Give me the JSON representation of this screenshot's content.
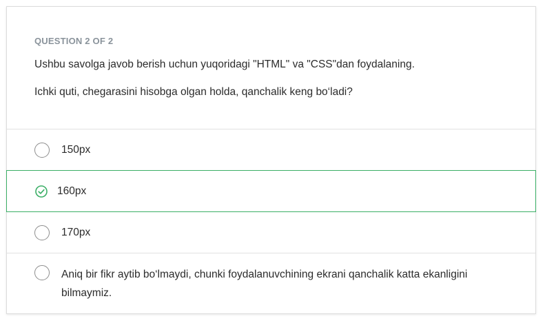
{
  "question": {
    "counter": "QUESTION 2 OF 2",
    "text": "Ushbu savolga javob berish uchun yuqoridagi \"HTML\" va \"CSS\"dan foydalaning.",
    "prompt": "Ichki quti, chegarasini hisobga olgan holda, qanchalik keng bo‘ladi?"
  },
  "answers": [
    {
      "label": "150px",
      "state": "unselected"
    },
    {
      "label": "160px",
      "state": "correct-selected"
    },
    {
      "label": "170px",
      "state": "unselected"
    },
    {
      "label": "Aniq bir fikr aytib bo‘lmaydi, chunki foydalanuvchining ekrani qanchalik katta ekanligini bilmaymiz.",
      "state": "unselected"
    }
  ],
  "colors": {
    "correct": "#3aae65",
    "counter": "#8a939b",
    "radio_border": "#8c8c8c",
    "divider": "#e1e1e1"
  },
  "icons": {
    "selected_answer": "check-circle-icon",
    "unselected_answer": "radio-circle-icon"
  }
}
